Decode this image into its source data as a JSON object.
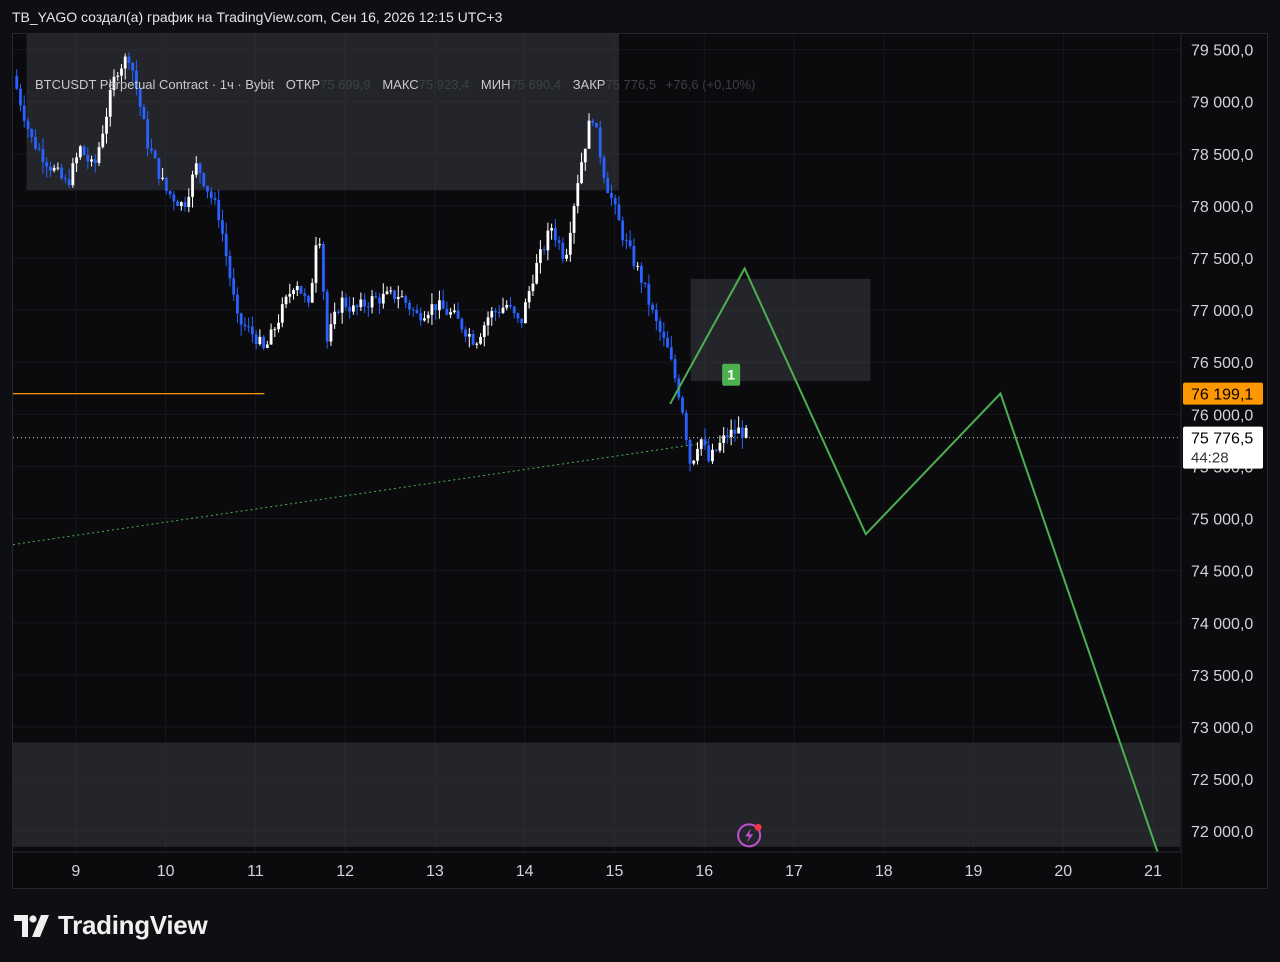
{
  "caption": "TB_YAGO создал(а) график на TradingView.com, Сен 16, 2026 12:15 UTC+3",
  "legend": {
    "symbol": "BTCUSDT Perpetual Contract · 1ч · Bybit",
    "open_label": "ОТКР",
    "open": "75 699,9",
    "high_label": "МАКС",
    "high": "75 923,4",
    "low_label": "МИН",
    "low": "75 690,4",
    "close_label": "ЗАКР",
    "close": "75 776,5",
    "change": "+76,6 (+0,10%)"
  },
  "price_label": {
    "value": "75 776,5",
    "countdown": "44:28",
    "y": 75776.5
  },
  "alert_label": {
    "value": "76 199,1",
    "y": 76199.1
  },
  "marker_label": "1",
  "footer": {
    "brand": "TradingView"
  },
  "colors": {
    "up": "#ffffff",
    "down": "#2962ff",
    "projection": "#4caf50",
    "alert": "#ff9800",
    "zone": "#3a3c44",
    "background": "#0b0b0e"
  },
  "icons": [
    "lightning-alert-icon",
    "tradingview-logo-icon"
  ],
  "chart_data": {
    "type": "candlestick",
    "interval": "1ч",
    "ylim": [
      71800,
      79650
    ],
    "yticks": [
      79500,
      79000,
      78500,
      78000,
      77500,
      77000,
      76500,
      76000,
      75500,
      75000,
      74500,
      74000,
      73500,
      73000,
      72500,
      72000
    ],
    "ytick_labels": [
      "79 500,0",
      "79 000,0",
      "78 500,0",
      "78 000,0",
      "77 500,0",
      "77 000,0",
      "76 500,0",
      "76 000,0",
      "75 500,0",
      "75 000,0",
      "74 500,0",
      "74 000,0",
      "73 500,0",
      "73 000,0",
      "72 500,0",
      "72 000,0"
    ],
    "xlim": [
      8.3,
      21.3
    ],
    "xticks": [
      9,
      10,
      11,
      12,
      13,
      14,
      15,
      16,
      17,
      18,
      19,
      20,
      21
    ],
    "xtick_labels": [
      "9",
      "10",
      "11",
      "12",
      "13",
      "14",
      "15",
      "16",
      "17",
      "18",
      "19",
      "20",
      "21"
    ],
    "price_path": [
      [
        8.3,
        79250
      ],
      [
        8.5,
        78650
      ],
      [
        8.7,
        78400
      ],
      [
        8.9,
        78200
      ],
      [
        9.05,
        78550
      ],
      [
        9.2,
        78350
      ],
      [
        9.45,
        79300
      ],
      [
        9.6,
        79450
      ],
      [
        9.8,
        78600
      ],
      [
        10.0,
        78150
      ],
      [
        10.2,
        78000
      ],
      [
        10.35,
        78400
      ],
      [
        10.6,
        77900
      ],
      [
        10.8,
        76900
      ],
      [
        11.0,
        76750
      ],
      [
        11.1,
        76600
      ],
      [
        11.25,
        76900
      ],
      [
        11.45,
        77300
      ],
      [
        11.6,
        77000
      ],
      [
        11.7,
        77900
      ],
      [
        11.8,
        76700
      ],
      [
        11.95,
        77100
      ],
      [
        12.1,
        77000
      ],
      [
        12.3,
        77100
      ],
      [
        12.6,
        77150
      ],
      [
        12.8,
        76950
      ],
      [
        13.0,
        77050
      ],
      [
        13.2,
        76950
      ],
      [
        13.45,
        76700
      ],
      [
        13.6,
        76950
      ],
      [
        13.8,
        77050
      ],
      [
        13.95,
        76850
      ],
      [
        14.1,
        77350
      ],
      [
        14.3,
        77800
      ],
      [
        14.45,
        77500
      ],
      [
        14.6,
        78300
      ],
      [
        14.75,
        78900
      ],
      [
        14.9,
        78250
      ],
      [
        15.1,
        77700
      ],
      [
        15.3,
        77300
      ],
      [
        15.45,
        76900
      ],
      [
        15.6,
        76600
      ],
      [
        15.75,
        76100
      ],
      [
        15.85,
        75500
      ],
      [
        15.95,
        75800
      ],
      [
        16.05,
        75550
      ],
      [
        16.25,
        75800
      ],
      [
        16.4,
        75850
      ],
      [
        16.5,
        75776.5
      ]
    ],
    "projection": {
      "x": [
        15.62,
        16.45,
        17.8,
        19.3,
        21.05
      ],
      "y": [
        76100,
        77400,
        74850,
        76200,
        71800
      ]
    },
    "zones": [
      {
        "x": [
          8.45,
          15.05
        ],
        "y": [
          78150,
          79650
        ]
      },
      {
        "x": [
          15.85,
          17.85
        ],
        "y": [
          76320,
          77300
        ]
      },
      {
        "x": [
          8.3,
          21.3
        ],
        "y": [
          71850,
          72850
        ]
      }
    ],
    "alert_line": {
      "x": [
        8.3,
        11.1
      ],
      "y": 76199.1
    },
    "trendline": {
      "x": [
        8.3,
        16.05
      ],
      "y": [
        74750,
        75730
      ]
    },
    "marker": {
      "x": 16.3,
      "y": 76380
    },
    "alert_icon": {
      "x": 16.5,
      "y": 71960
    }
  }
}
